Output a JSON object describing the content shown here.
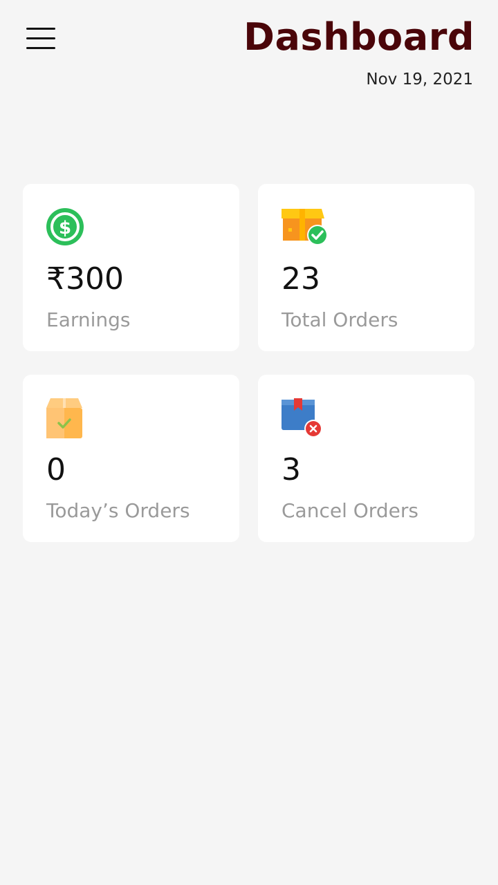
{
  "header": {
    "title": "Dashboard",
    "date": "Nov 19, 2021",
    "menu_icon": "hamburger-menu-icon"
  },
  "cards": [
    {
      "value": "₹300",
      "label": "Earnings",
      "icon": "dollar-coin-icon"
    },
    {
      "value": "23",
      "label": "Total Orders",
      "icon": "box-check-icon"
    },
    {
      "value": "0",
      "label": "Today’s Orders",
      "icon": "package-check-icon"
    },
    {
      "value": "3",
      "label": "Cancel Orders",
      "icon": "box-cancel-icon"
    }
  ],
  "colors": {
    "background": "#f5f5f5",
    "title": "#4a0509",
    "label": "#9a9a9a",
    "card": "#ffffff"
  }
}
